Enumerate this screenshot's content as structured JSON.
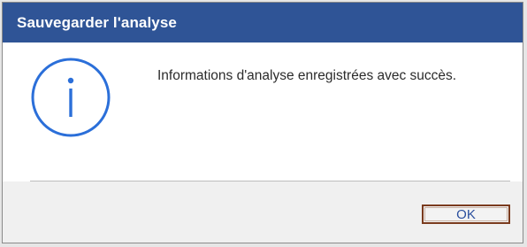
{
  "dialog": {
    "title": "Sauvegarder l'analyse",
    "message": "Informations d'analyse enregistrées avec succès.",
    "icon": "info-icon",
    "ok_label": "OK"
  },
  "colors": {
    "titlebar": "#2f5496",
    "icon": "#2b6fd9",
    "button_border": "#7a3b1e",
    "button_text": "#2a4f9e"
  }
}
